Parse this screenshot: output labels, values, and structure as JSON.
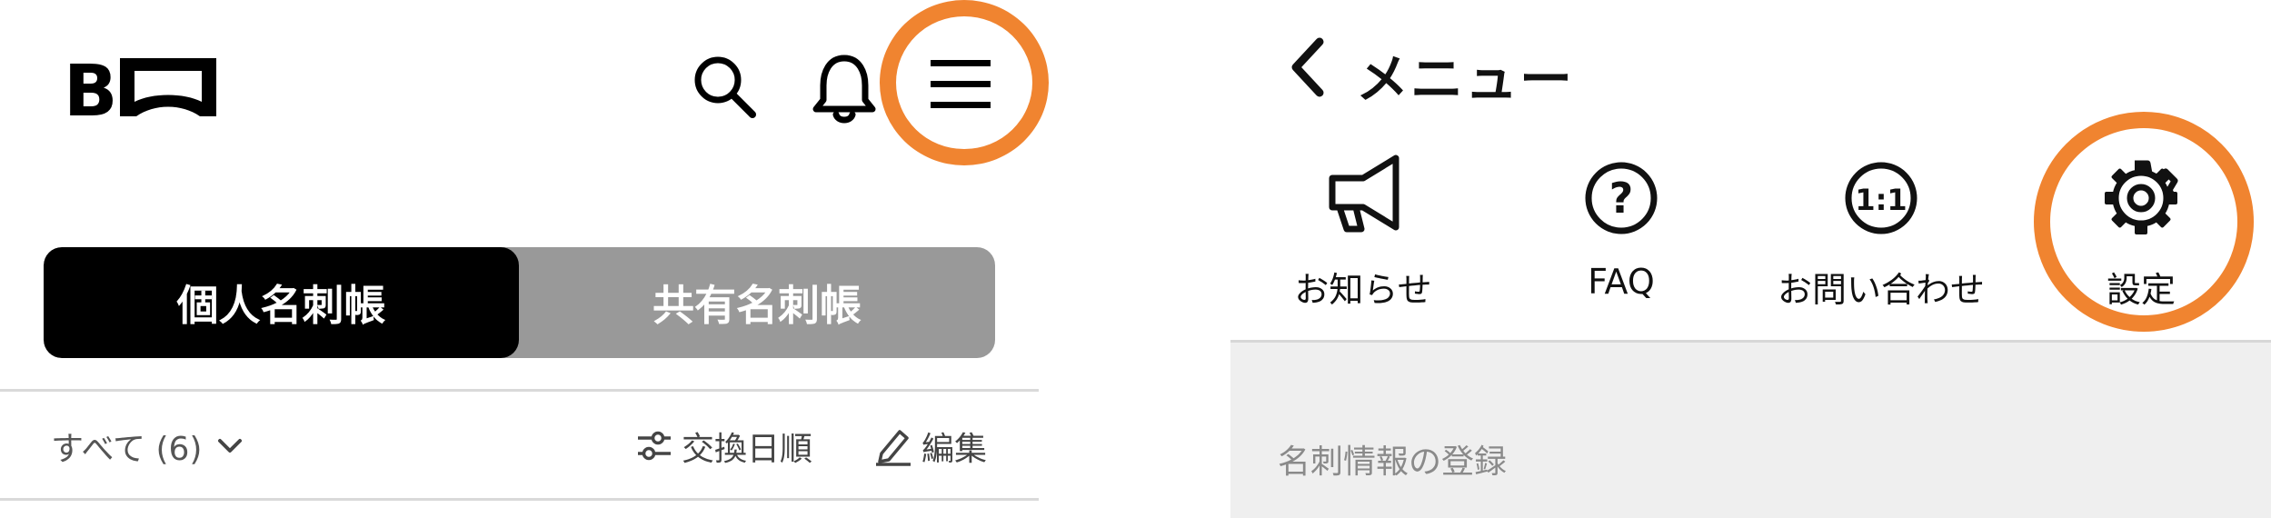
{
  "left": {
    "logo_text": "B",
    "header_icons": [
      "search-icon",
      "bell-icon",
      "menu-icon"
    ],
    "segmented": {
      "personal": "個人名刺帳",
      "shared": "共有名刺帳"
    },
    "filter": {
      "all_label": "すべて (6)",
      "sort_label": "交換日順",
      "edit_label": "編集"
    }
  },
  "right": {
    "back_icon": "chevron-left-icon",
    "title": "メニュー",
    "menu_items": [
      {
        "label": "お知らせ",
        "icon": "megaphone-icon"
      },
      {
        "label": "FAQ",
        "icon": "question-circle-icon"
      },
      {
        "label": "お問い合わせ",
        "icon": "one-to-one-icon"
      },
      {
        "label": "設定",
        "icon": "gear-icon"
      }
    ],
    "section_label": "名刺情報の登録"
  },
  "colors": {
    "accent": "#F08430",
    "segment_active": "#000000",
    "segment_inactive": "#999999",
    "band": "#efefef"
  }
}
